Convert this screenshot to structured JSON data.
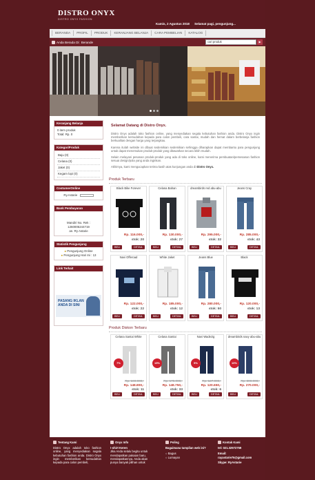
{
  "header": {
    "logo": "DISTRO ONYX",
    "tagline": "DISTRO ONYX FASHION",
    "date": "Kamis, 2 Agustus 2018",
    "greeting": "Selamat pagi, pengunjung..."
  },
  "nav": [
    "BERANDA",
    "PROFIL",
    "PRODUK",
    "KERANJANG BELANJA",
    "CARA PEMBELIAN",
    "KATALOG"
  ],
  "crumb": {
    "prefix": "Anda Berada Di:",
    "current": "Berande"
  },
  "search": {
    "value": "cari produk",
    "button": "▶"
  },
  "sidebar": {
    "cart": {
      "title": "Keranjang Belanja",
      "items": "0 item produk",
      "total": "Total: Rp. 0"
    },
    "category": {
      "title": "KategoriProduk",
      "items": [
        "Baju (0)",
        "Celana (0)",
        "Jaket (0)",
        "Kegam lopi (0)"
      ]
    },
    "cs": {
      "title": "CostumerOnline",
      "name": "Ry.Astarie"
    },
    "bank": {
      "title": "Bank Pembayaran",
      "lines": [
        "Mandiri No. Rek :",
        "1260005244719",
        "an. Ry Astarie"
      ]
    },
    "stats": {
      "title": "Statistik Pengunjung",
      "online": "Pengunjung Online",
      "today": "Pengunjung Hari Ini : 13"
    },
    "links": {
      "title": "Link Terkait",
      "ad": "PASANG IKLAN ANDA DI SINI"
    }
  },
  "welcome": {
    "title": "Selamat Datang di Distro Onyx.",
    "p1": "Distro Onyx adalah toko fashion online, yang menyediakan segala kebutuhan fashion anda. Distro Onyx ingin memberikan kemudahan kepada para calon pembeli, cara santai, mudah dan hemat dalam berbelanja fashion berkualitas dengan harga yang terjangkau.",
    "p2": "Karena itulah website ini dibuat sedemikian sedemikian sehingga diharapkan dapat membantu para pengunjung untuk dapat menemukan produk-produk yang ditawarkan secara lebih mudah.",
    "p3": "Selain melayani pesanan produk-produk yang ada di toko online, kami menerima pembuatan/pemesanan fashion sesuai design/pola yang anda inginkan.",
    "p4a": "Akhirnya, kami mengucapkan terima kasih atas kunjungan anda di ",
    "p4b": "Distro Onyx."
  },
  "new_products": {
    "title": "Produk Terbaru",
    "buy": "BELI",
    "detail": "DETAIL",
    "items": [
      {
        "name": "Black Bike Forever",
        "price": "Rp. 116.000,-",
        "stock": "stok: 20",
        "kind": "tee-black-bike"
      },
      {
        "name": "Celana Bahan",
        "price": "Rp. 130.000,-",
        "stock": "stok: 27",
        "kind": "pants-dark"
      },
      {
        "name": "dreambirds red abu-abu",
        "price": "Rp. 295.000,-",
        "stock": "stok: 32",
        "kind": "jacket-grey-red"
      },
      {
        "name": "Jeans Cray",
        "price": "Rp. 285.000,-",
        "stock": "stok: 43",
        "kind": "jeans"
      },
      {
        "name": "Navi Offeroad",
        "price": "Rp. 122.000,-",
        "stock": "stok: 22",
        "kind": "tee-navy"
      },
      {
        "name": "White Jaket",
        "price": "Rp. 185.000,-",
        "stock": "stok: 12",
        "kind": "jacket-white"
      },
      {
        "name": "Jeans Blue",
        "price": "Rp. 280.000,-",
        "stock": "stok: 50",
        "kind": "jeans"
      },
      {
        "name": "Black",
        "price": "Rp. 120.000,-",
        "stock": "stok: 13",
        "kind": "tee-black"
      }
    ]
  },
  "discount_products": {
    "title": "Produk Diskon Terbaru",
    "items": [
      {
        "name": "Celana Santai White",
        "old": "Rp. 160.000,-",
        "price": "Rp. 148.800,-",
        "stock": "stok: 11",
        "badge": "7%"
      },
      {
        "name": "Celana Santai",
        "old": "Rp. 175.000,-",
        "price": "Rp. 148.750,-",
        "stock": "stok: 33",
        "badge": "15%"
      },
      {
        "name": "Navi Wadezig",
        "old": "Rp. 127.000,-",
        "price": "Rp. 120.650,-",
        "stock": "stok: 6",
        "badge": "5%"
      },
      {
        "name": "dreambirds navy abu-abu",
        "old": "Rp. 300.000,-",
        "price": "Rp. 270.000,-",
        "stock": "",
        "badge": "10%"
      }
    ]
  },
  "footer": {
    "about": {
      "title": "Tentang Kami",
      "text": "Distro Onyx adalah toko fashion online, yang menyediakan segala kebutuhan fashion anda. Distro Onyx ingin memberikan kemudahan kepada para calon pembeli,"
    },
    "info": {
      "title": "Onyx Info",
      "headline": "!-shirt Keren",
      "text": "Jika Anda selalu begitu untuk mendapatkan pakaian baru, mendapatkannya. Anda akan punya banyak pilihan untuk"
    },
    "poll": {
      "title": "Poling",
      "question": "Bagaimana tampilan web ini?",
      "options": [
        "Bagus",
        "Lumayan"
      ]
    },
    "contact": {
      "title": "Kontak Kami",
      "tel": "tel: 021.32972759",
      "email_label": "Email:",
      "email": "rayastarie76@gmail.com",
      "skype": "Skype: RyAstarie"
    }
  },
  "colors": {
    "brand": "#7b1e27",
    "dark": "#5b1a20",
    "price": "#c0392b"
  }
}
